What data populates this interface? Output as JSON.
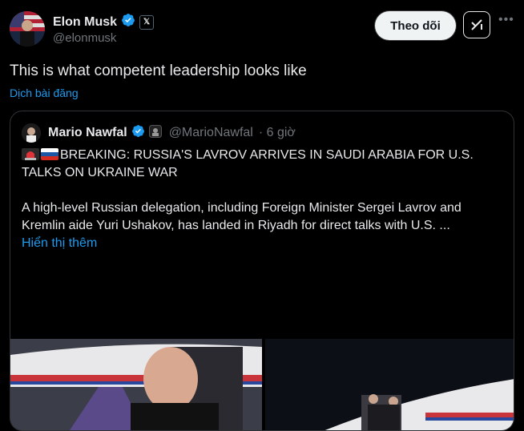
{
  "author": {
    "display_name": "Elon Musk",
    "handle": "@elonmusk",
    "verified_icon": "verified-badge-icon",
    "affiliation_icon": "x-logo-icon"
  },
  "actions": {
    "follow_label": "Theo dõi",
    "grok_icon": "grok-icon",
    "more_icon": "more-icon"
  },
  "tweet": {
    "text": "This is what competent leadership looks like",
    "translate_label": "Dịch bài đăng"
  },
  "quote": {
    "display_name": "Mario Nawfal",
    "handle": "@MarioNawfal",
    "time": "· 6 giờ",
    "headline": "BREAKING: RUSSIA'S LAVROV ARRIVES IN SAUDI ARABIA FOR U.S. TALKS ON UKRAINE WAR",
    "body": "A high-level Russian delegation, including Foreign Minister Sergei Lavrov and Kremlin aide Yuri Ushakov, has landed in Riyadh for direct talks with U.S. ...",
    "show_more_label": "Hiển thị thêm",
    "headline_icons": [
      "siren-emoji",
      "russia-flag-emoji"
    ]
  },
  "colors": {
    "background": "#000000",
    "text": "#e7e9ea",
    "secondary": "#71767b",
    "link": "#1d9bf0",
    "border": "#2f3336",
    "verified": "#1d9bf0"
  }
}
